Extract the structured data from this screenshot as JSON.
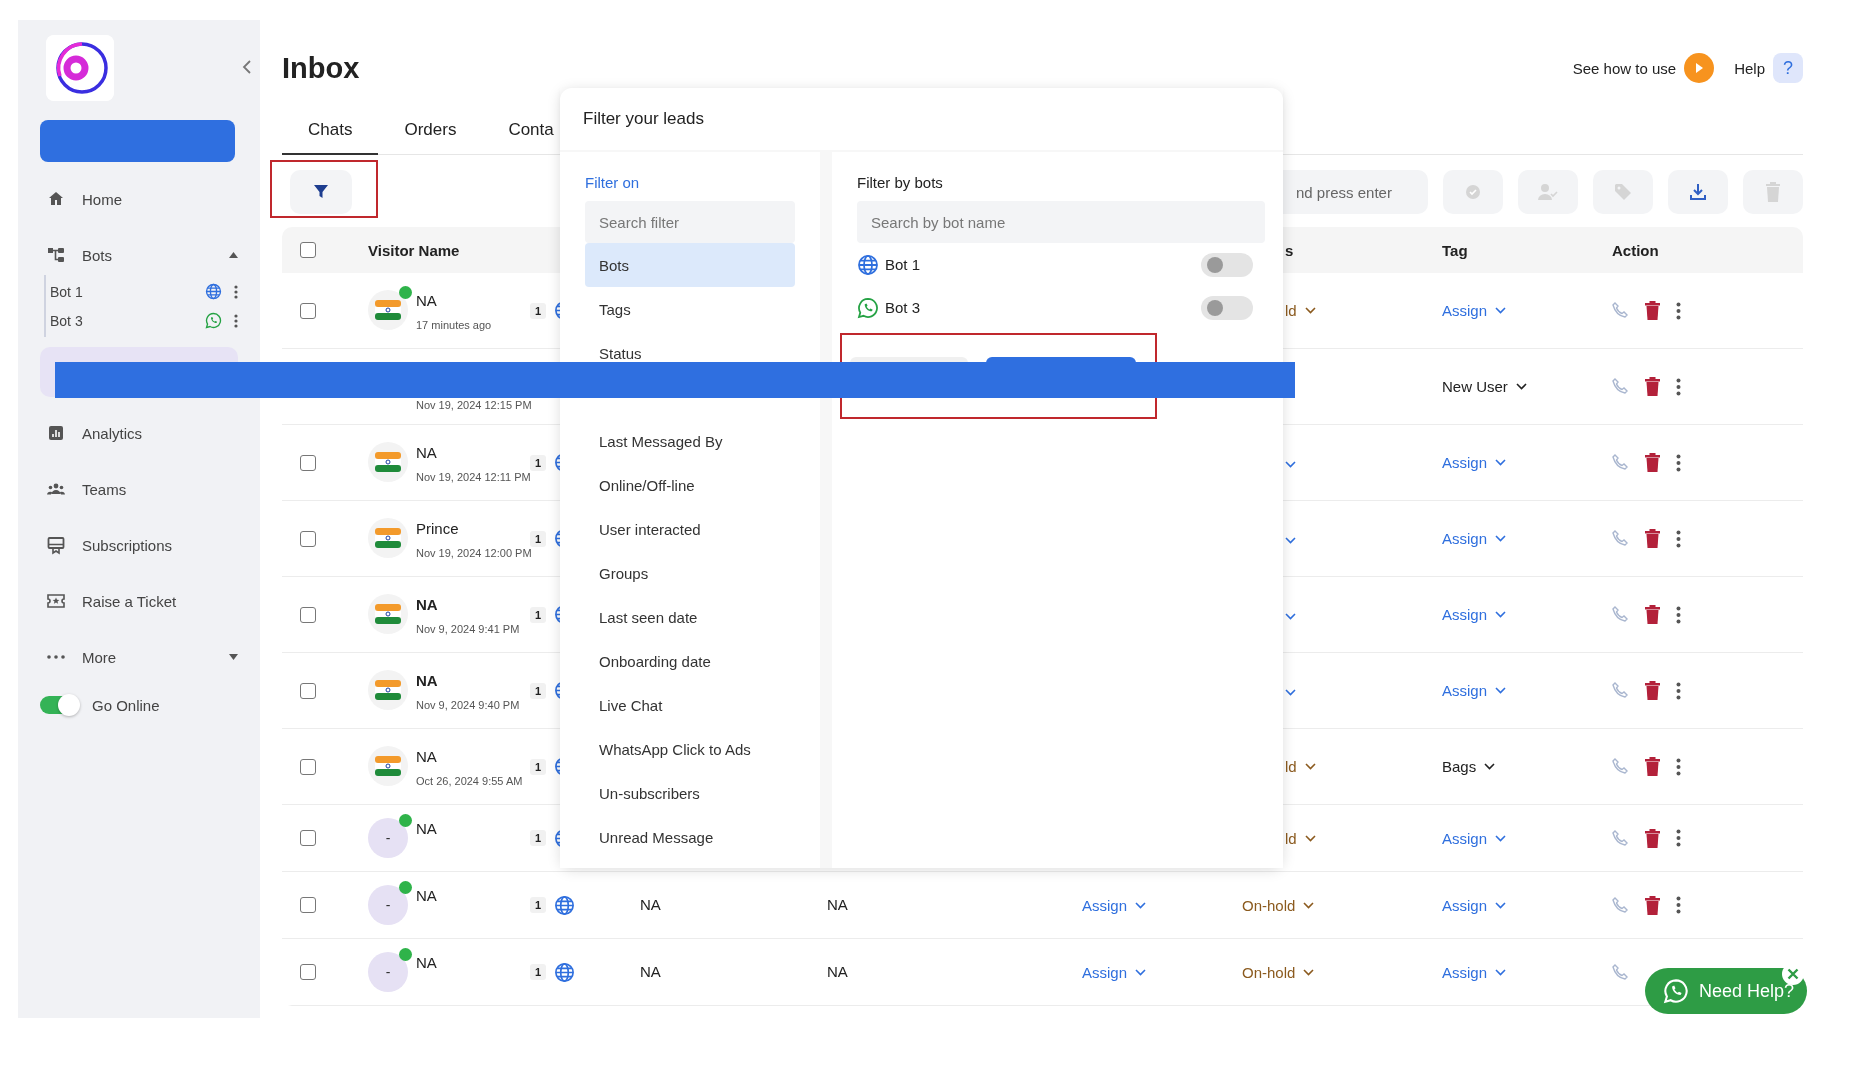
{
  "sidebar": {
    "nav": [
      {
        "kind": "link",
        "label": "Home"
      },
      {
        "kind": "group",
        "label": "Bots",
        "expanded": true,
        "children": [
          {
            "label": "Bot 1",
            "kind": "web"
          },
          {
            "label": "Bot 3",
            "kind": "whatsapp"
          }
        ]
      },
      {
        "kind": "covered",
        "selected": true
      },
      {
        "kind": "link",
        "label": "Analytics"
      },
      {
        "kind": "link",
        "label": "Teams"
      },
      {
        "kind": "link",
        "label": "Subscriptions"
      },
      {
        "kind": "link",
        "label": "Raise a Ticket"
      },
      {
        "kind": "menu",
        "label": "More",
        "expanded": false
      },
      {
        "kind": "toggle",
        "label": "Go Online",
        "on": true
      }
    ]
  },
  "header": {
    "title": "Inbox",
    "how_to": "See how to use",
    "help": "Help",
    "help_icon": "?"
  },
  "tabs": [
    {
      "label": "Chats",
      "selected": true
    },
    {
      "label": "Orders",
      "selected": false
    },
    {
      "label": "Conta",
      "selected": false
    }
  ],
  "toolbar": {
    "search": {
      "placeholder": "nd press enter"
    },
    "actions": [
      {
        "kind": "resolve",
        "disabled": true
      },
      {
        "kind": "assign",
        "disabled": true
      },
      {
        "kind": "tag",
        "disabled": true
      },
      {
        "kind": "download",
        "disabled": false
      },
      {
        "kind": "delete",
        "disabled": true
      }
    ]
  },
  "table": {
    "all_checked": false,
    "columns": [
      {
        "kind": "visitor",
        "label": "Visitor Name"
      },
      {
        "kind": "status",
        "label": "s",
        "partial": true
      },
      {
        "kind": "tag",
        "label": "Tag"
      },
      {
        "kind": "action",
        "label": "Action"
      }
    ],
    "rows": [
      {
        "kind": "flag",
        "checked": false,
        "online": true,
        "name": "NA",
        "unread": false,
        "time": "17 minutes ago",
        "badge": "1",
        "status": {
          "label": "ld",
          "partial": true
        },
        "tag": {
          "label": "Assign",
          "set": false
        }
      },
      {
        "kind": "covered",
        "time": "Nov 19, 2024 12:15 PM",
        "tag": {
          "label": "New User",
          "set": true
        }
      },
      {
        "kind": "flag",
        "checked": false,
        "online": false,
        "name": "NA",
        "unread": false,
        "time": "Nov 19, 2024 12:11 PM",
        "badge": "1",
        "status": {
          "partial": true
        },
        "tag": {
          "label": "Assign",
          "set": false
        }
      },
      {
        "kind": "flag",
        "checked": false,
        "online": false,
        "name": "Prince",
        "unread": false,
        "time": "Nov 19, 2024 12:00 PM",
        "badge": "1",
        "status": {
          "partial": true
        },
        "tag": {
          "label": "Assign",
          "set": false
        }
      },
      {
        "kind": "flag",
        "checked": false,
        "online": false,
        "name": "NA",
        "unread": true,
        "time": "Nov 9, 2024 9:41 PM",
        "badge": "1",
        "status": {
          "partial": true
        },
        "tag": {
          "label": "Assign",
          "set": false
        }
      },
      {
        "kind": "flag",
        "checked": false,
        "online": false,
        "name": "NA",
        "unread": true,
        "time": "Nov 9, 2024 9:40 PM",
        "badge": "1",
        "status": {
          "partial": true
        },
        "tag": {
          "label": "Assign",
          "set": false
        }
      },
      {
        "kind": "flag",
        "checked": false,
        "online": false,
        "name": "NA",
        "unread": false,
        "time": "Oct 26, 2024 9:55 AM",
        "badge": "1",
        "status": {
          "label": "ld",
          "partial": true
        },
        "tag": {
          "label": "Bags",
          "set": true
        }
      },
      {
        "kind": "initial",
        "checked": false,
        "initial": "-",
        "online": true,
        "name": "NA",
        "unread": false,
        "badge": "1",
        "status": {
          "label": "ld",
          "partial": true
        },
        "tag": {
          "label": "Assign",
          "set": false
        }
      },
      {
        "kind": "initial",
        "checked": false,
        "initial": "-",
        "online": true,
        "name": "NA",
        "unread": false,
        "badge": "1",
        "column_4": "NA",
        "column_5": "NA",
        "agent": "Assign",
        "status": {
          "label": "On-hold",
          "partial": false
        },
        "tag": {
          "label": "Assign",
          "set": false
        }
      },
      {
        "kind": "initial",
        "checked": false,
        "initial": "-",
        "online": true,
        "name": "NA",
        "unread": false,
        "badge": "1",
        "column_4": "NA",
        "column_5": "NA",
        "agent": "Assign",
        "status": {
          "label": "On-hold",
          "partial": false
        },
        "tag": {
          "label": "Assign",
          "set": false
        }
      }
    ]
  },
  "filter": {
    "title": "Filter your leads",
    "left_heading": "Filter on",
    "search_placeholder": "Search filter",
    "options": [
      {
        "label": "Bots",
        "selected": true
      },
      {
        "label": "Tags",
        "selected": false
      },
      {
        "label": "Status",
        "selected": false
      },
      {
        "kind": "covered"
      },
      {
        "label": "Last Messaged By",
        "selected": false
      },
      {
        "label": "Online/Off-line",
        "selected": false
      },
      {
        "label": "User interacted",
        "selected": false
      },
      {
        "label": "Groups",
        "selected": false
      },
      {
        "label": "Last seen date",
        "selected": false
      },
      {
        "label": "Onboarding date",
        "selected": false
      },
      {
        "label": "Live Chat",
        "selected": false
      },
      {
        "label": "WhatsApp Click to Ads",
        "selected": false
      },
      {
        "label": "Un-subscribers",
        "selected": false
      },
      {
        "label": "Unread Message",
        "selected": false
      }
    ],
    "right_heading": "Filter by bots",
    "bot_search_placeholder": "Search by bot name",
    "bots": [
      {
        "label": "Bot 1",
        "kind": "web",
        "on": false
      },
      {
        "label": "Bot 3",
        "kind": "whatsapp",
        "on": false
      }
    ]
  },
  "need_help": {
    "label": "Need Help?"
  }
}
